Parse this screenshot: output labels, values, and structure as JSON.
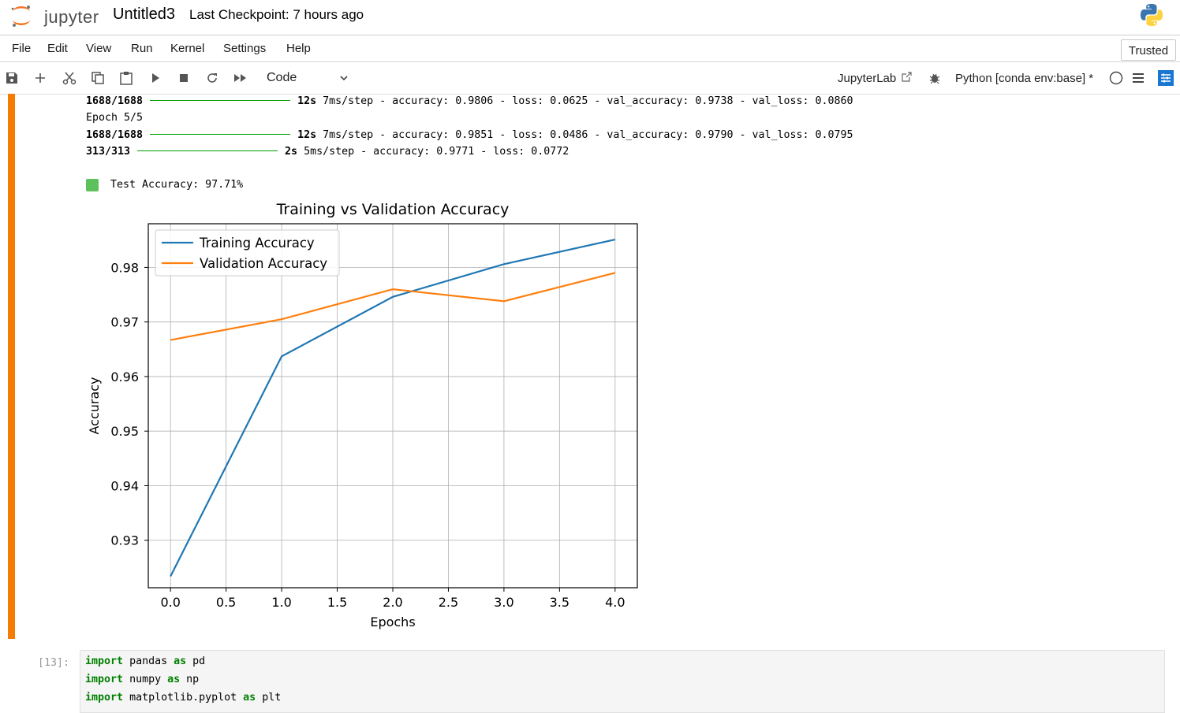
{
  "app": {
    "brand": "jupyter",
    "notebook_title": "Untitled3",
    "checkpoint": "Last Checkpoint: 7 hours ago",
    "python_logo_icon": "python-logo-icon"
  },
  "menu": [
    "File",
    "Edit",
    "View",
    "Run",
    "Kernel",
    "Settings",
    "Help"
  ],
  "trusted_label": "Trusted",
  "toolbar": {
    "cell_type": "Code",
    "jupyterlab_label": "JupyterLab",
    "kernel_label": "Python [conda env:base] *",
    "icons": [
      "save-icon",
      "add-cell-icon",
      "cut-icon",
      "copy-icon",
      "paste-icon",
      "run-icon",
      "stop-icon",
      "restart-icon",
      "fast-forward-icon",
      "external-link-icon",
      "debugger-bug-icon",
      "kernel-status-circle-icon",
      "menu-lines-icon",
      "property-inspector-icon"
    ]
  },
  "output": {
    "line1": {
      "step": "1688/1688",
      "time": "12s",
      "rest": "7ms/step - accuracy: 0.9806 - loss: 0.0625 - val_accuracy: 0.9738 - val_loss: 0.0860"
    },
    "line2": "Epoch 5/5",
    "line3": {
      "step": "1688/1688",
      "time": "12s",
      "rest": "7ms/step - accuracy: 0.9851 - loss: 0.0486 - val_accuracy: 0.9790 - val_loss: 0.0795"
    },
    "line4": {
      "step": "313/313",
      "time": "2s",
      "rest": "5ms/step - accuracy: 0.9771 - loss: 0.0772"
    },
    "test_accuracy": "Test Accuracy: 97.71%"
  },
  "chart_data": {
    "type": "line",
    "title": "Training vs Validation Accuracy",
    "xlabel": "Epochs",
    "ylabel": "Accuracy",
    "x": [
      0,
      1,
      2,
      3,
      4
    ],
    "series": [
      {
        "name": "Training Accuracy",
        "color": "#1f77b4",
        "values": [
          0.9234,
          0.9637,
          0.9746,
          0.9806,
          0.9851
        ]
      },
      {
        "name": "Validation Accuracy",
        "color": "#ff7f0e",
        "values": [
          0.9667,
          0.9705,
          0.976,
          0.9738,
          0.979
        ]
      }
    ],
    "xticks": [
      "0.0",
      "0.5",
      "1.0",
      "1.5",
      "2.0",
      "2.5",
      "3.0",
      "3.5",
      "4.0"
    ],
    "yticks": [
      "0.93",
      "0.94",
      "0.95",
      "0.96",
      "0.97",
      "0.98"
    ],
    "xlim": [
      -0.2,
      4.2
    ],
    "ylim": [
      0.9213,
      0.988
    ],
    "grid": true,
    "legend": "top-left"
  },
  "next_cell": {
    "prompt": "[13]:",
    "lines": [
      {
        "kw1": "import",
        "mod": "pandas",
        "kw2": "as",
        "alias": "pd"
      },
      {
        "kw1": "import",
        "mod": "numpy",
        "kw2": "as",
        "alias": "np"
      },
      {
        "kw1": "import",
        "mod": "matplotlib.pyplot",
        "kw2": "as",
        "alias": "plt"
      }
    ]
  }
}
